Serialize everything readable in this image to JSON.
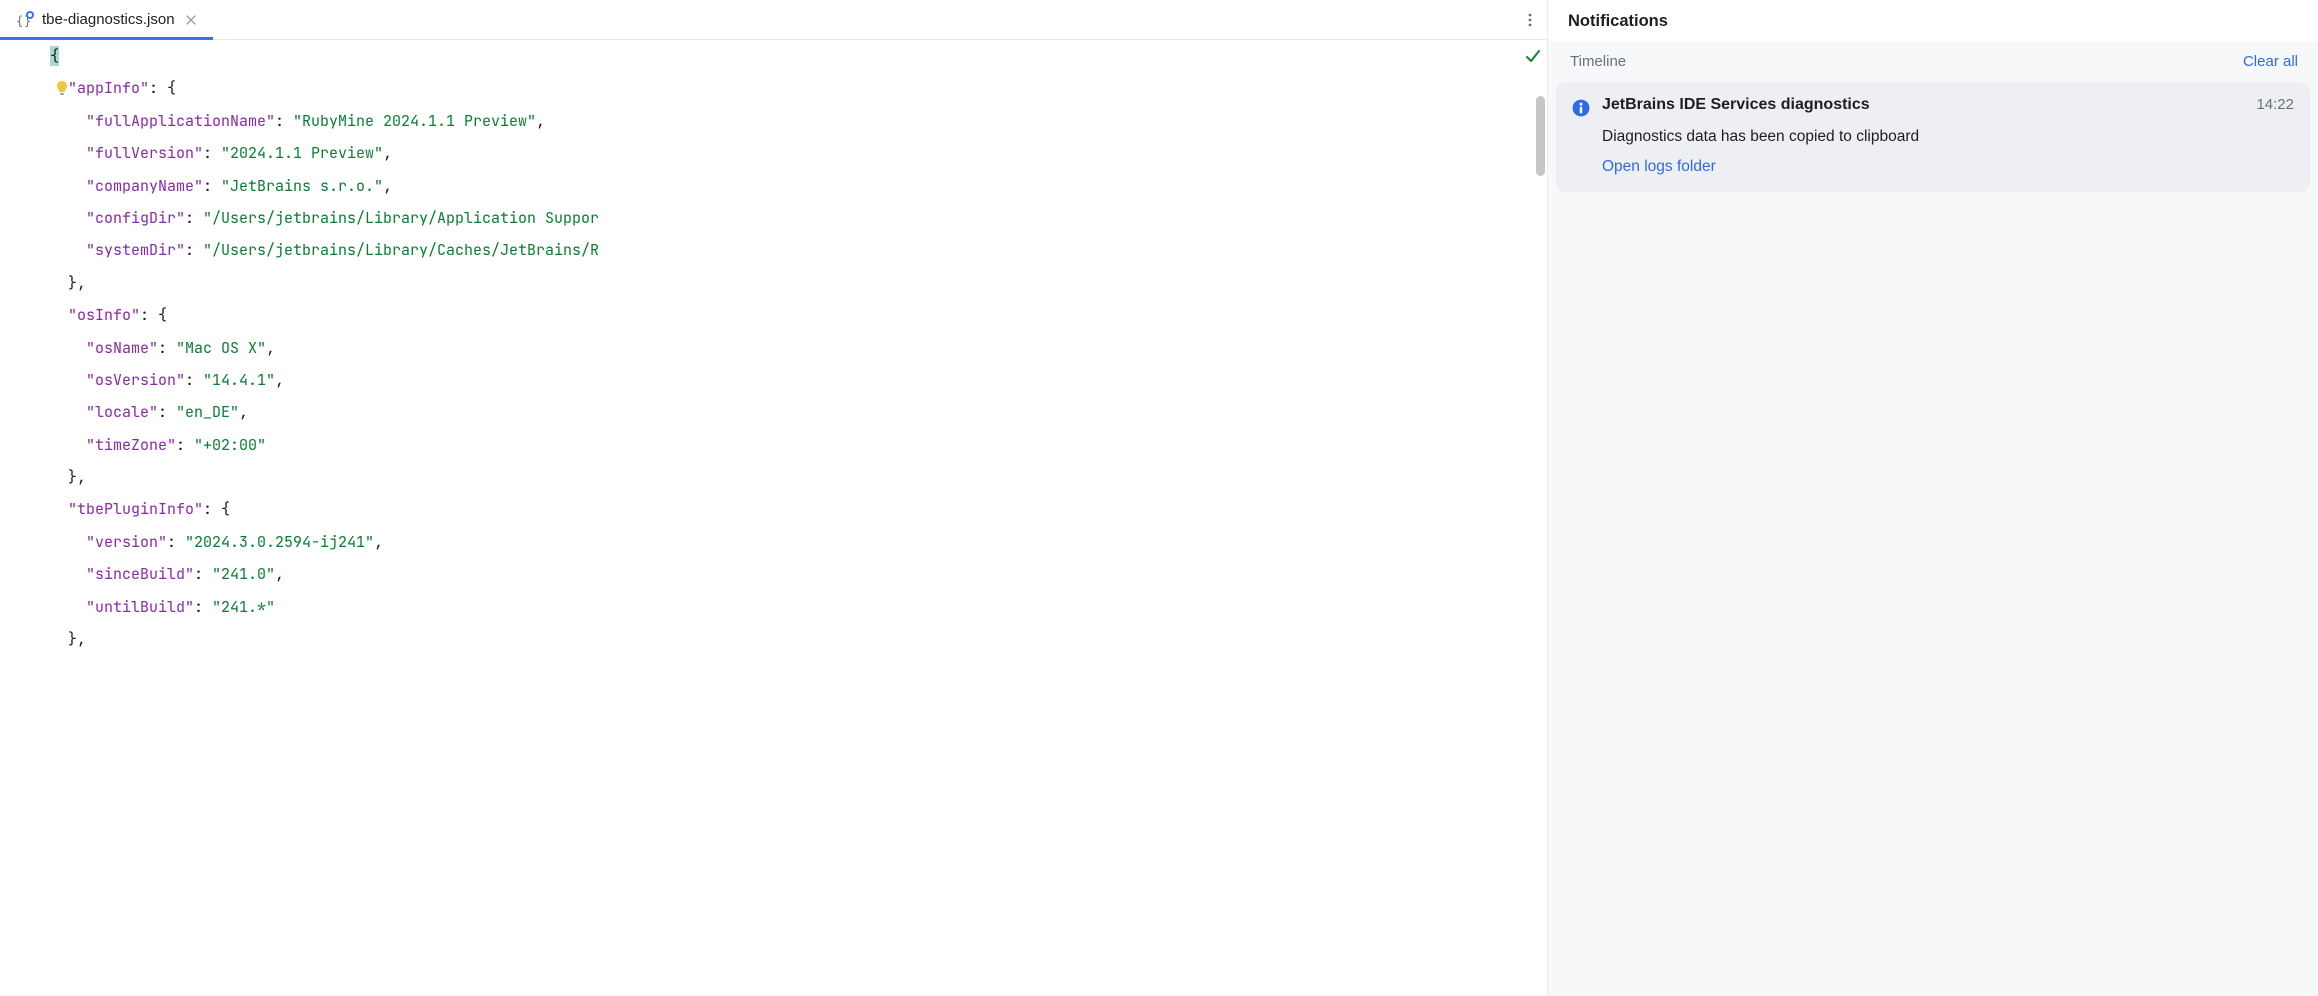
{
  "tab": {
    "filename": "tbe-diagnostics.json",
    "icon": "json-file-icon"
  },
  "status": {
    "ok_icon": "check-ok-icon"
  },
  "code": {
    "lines": [
      {
        "indent": 0,
        "segments": [
          {
            "t": "brace_hl",
            "v": "{"
          }
        ]
      },
      {
        "indent": 1,
        "segments": [
          {
            "t": "key",
            "v": "\"appInfo\""
          },
          {
            "t": "punct",
            "v": ": {"
          }
        ]
      },
      {
        "indent": 2,
        "segments": [
          {
            "t": "key",
            "v": "\"fullApplicationName\""
          },
          {
            "t": "punct",
            "v": ": "
          },
          {
            "t": "str",
            "v": "\"RubyMine 2024.1.1 Preview\""
          },
          {
            "t": "punct",
            "v": ","
          }
        ]
      },
      {
        "indent": 2,
        "segments": [
          {
            "t": "key",
            "v": "\"fullVersion\""
          },
          {
            "t": "punct",
            "v": ": "
          },
          {
            "t": "str",
            "v": "\"2024.1.1 Preview\""
          },
          {
            "t": "punct",
            "v": ","
          }
        ]
      },
      {
        "indent": 2,
        "segments": [
          {
            "t": "key",
            "v": "\"companyName\""
          },
          {
            "t": "punct",
            "v": ": "
          },
          {
            "t": "str",
            "v": "\"JetBrains s.r.o.\""
          },
          {
            "t": "punct",
            "v": ","
          }
        ]
      },
      {
        "indent": 2,
        "segments": [
          {
            "t": "key",
            "v": "\"configDir\""
          },
          {
            "t": "punct",
            "v": ": "
          },
          {
            "t": "str",
            "v": "\"/Users/jetbrains/Library/Application Suppor"
          }
        ]
      },
      {
        "indent": 2,
        "segments": [
          {
            "t": "key",
            "v": "\"systemDir\""
          },
          {
            "t": "punct",
            "v": ": "
          },
          {
            "t": "str",
            "v": "\"/Users/jetbrains/Library/Caches/JetBrains/R"
          }
        ]
      },
      {
        "indent": 1,
        "segments": [
          {
            "t": "punct",
            "v": "},"
          }
        ]
      },
      {
        "indent": 1,
        "segments": [
          {
            "t": "key",
            "v": "\"osInfo\""
          },
          {
            "t": "punct",
            "v": ": {"
          }
        ]
      },
      {
        "indent": 2,
        "segments": [
          {
            "t": "key",
            "v": "\"osName\""
          },
          {
            "t": "punct",
            "v": ": "
          },
          {
            "t": "str",
            "v": "\"Mac OS X\""
          },
          {
            "t": "punct",
            "v": ","
          }
        ]
      },
      {
        "indent": 2,
        "segments": [
          {
            "t": "key",
            "v": "\"osVersion\""
          },
          {
            "t": "punct",
            "v": ": "
          },
          {
            "t": "str",
            "v": "\"14.4.1\""
          },
          {
            "t": "punct",
            "v": ","
          }
        ]
      },
      {
        "indent": 2,
        "segments": [
          {
            "t": "key",
            "v": "\"locale\""
          },
          {
            "t": "punct",
            "v": ": "
          },
          {
            "t": "str",
            "v": "\"en_DE\""
          },
          {
            "t": "punct",
            "v": ","
          }
        ]
      },
      {
        "indent": 2,
        "segments": [
          {
            "t": "key",
            "v": "\"timeZone\""
          },
          {
            "t": "punct",
            "v": ": "
          },
          {
            "t": "str",
            "v": "\"+02:00\""
          }
        ]
      },
      {
        "indent": 1,
        "segments": [
          {
            "t": "punct",
            "v": "},"
          }
        ]
      },
      {
        "indent": 1,
        "segments": [
          {
            "t": "key",
            "v": "\"tbePluginInfo\""
          },
          {
            "t": "punct",
            "v": ": {"
          }
        ]
      },
      {
        "indent": 2,
        "segments": [
          {
            "t": "key",
            "v": "\"version\""
          },
          {
            "t": "punct",
            "v": ": "
          },
          {
            "t": "str",
            "v": "\"2024.3.0.2594-ij241\""
          },
          {
            "t": "punct",
            "v": ","
          }
        ]
      },
      {
        "indent": 2,
        "segments": [
          {
            "t": "key",
            "v": "\"sinceBuild\""
          },
          {
            "t": "punct",
            "v": ": "
          },
          {
            "t": "str",
            "v": "\"241.0\""
          },
          {
            "t": "punct",
            "v": ","
          }
        ]
      },
      {
        "indent": 2,
        "segments": [
          {
            "t": "key",
            "v": "\"untilBuild\""
          },
          {
            "t": "punct",
            "v": ": "
          },
          {
            "t": "str",
            "v": "\"241.*\""
          }
        ]
      },
      {
        "indent": 1,
        "segments": [
          {
            "t": "punct",
            "v": "},"
          }
        ]
      }
    ]
  },
  "notifications": {
    "title": "Notifications",
    "timeline_label": "Timeline",
    "clear_all_label": "Clear all",
    "items": [
      {
        "title": "JetBrains IDE Services diagnostics",
        "time": "14:22",
        "message": "Diagnostics data has been copied to clipboard",
        "action_label": "Open logs folder"
      }
    ]
  }
}
